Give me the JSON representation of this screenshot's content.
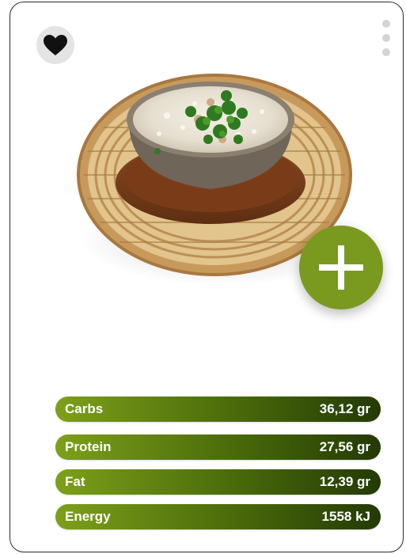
{
  "nutrition": [
    {
      "label": "Carbs",
      "value": "36,12 gr"
    },
    {
      "label": "Protein",
      "value": "27,56 gr"
    },
    {
      "label": "Fat",
      "value": "12,39 gr"
    },
    {
      "label": "Energy",
      "value": "1558 kJ"
    }
  ],
  "colors": {
    "accent": "#7a9a1f",
    "bar_start": "#7da01a",
    "bar_end": "#233a05"
  },
  "icons": {
    "favorite": "heart-icon",
    "menu": "more-vertical-icon",
    "add": "plus-icon"
  }
}
